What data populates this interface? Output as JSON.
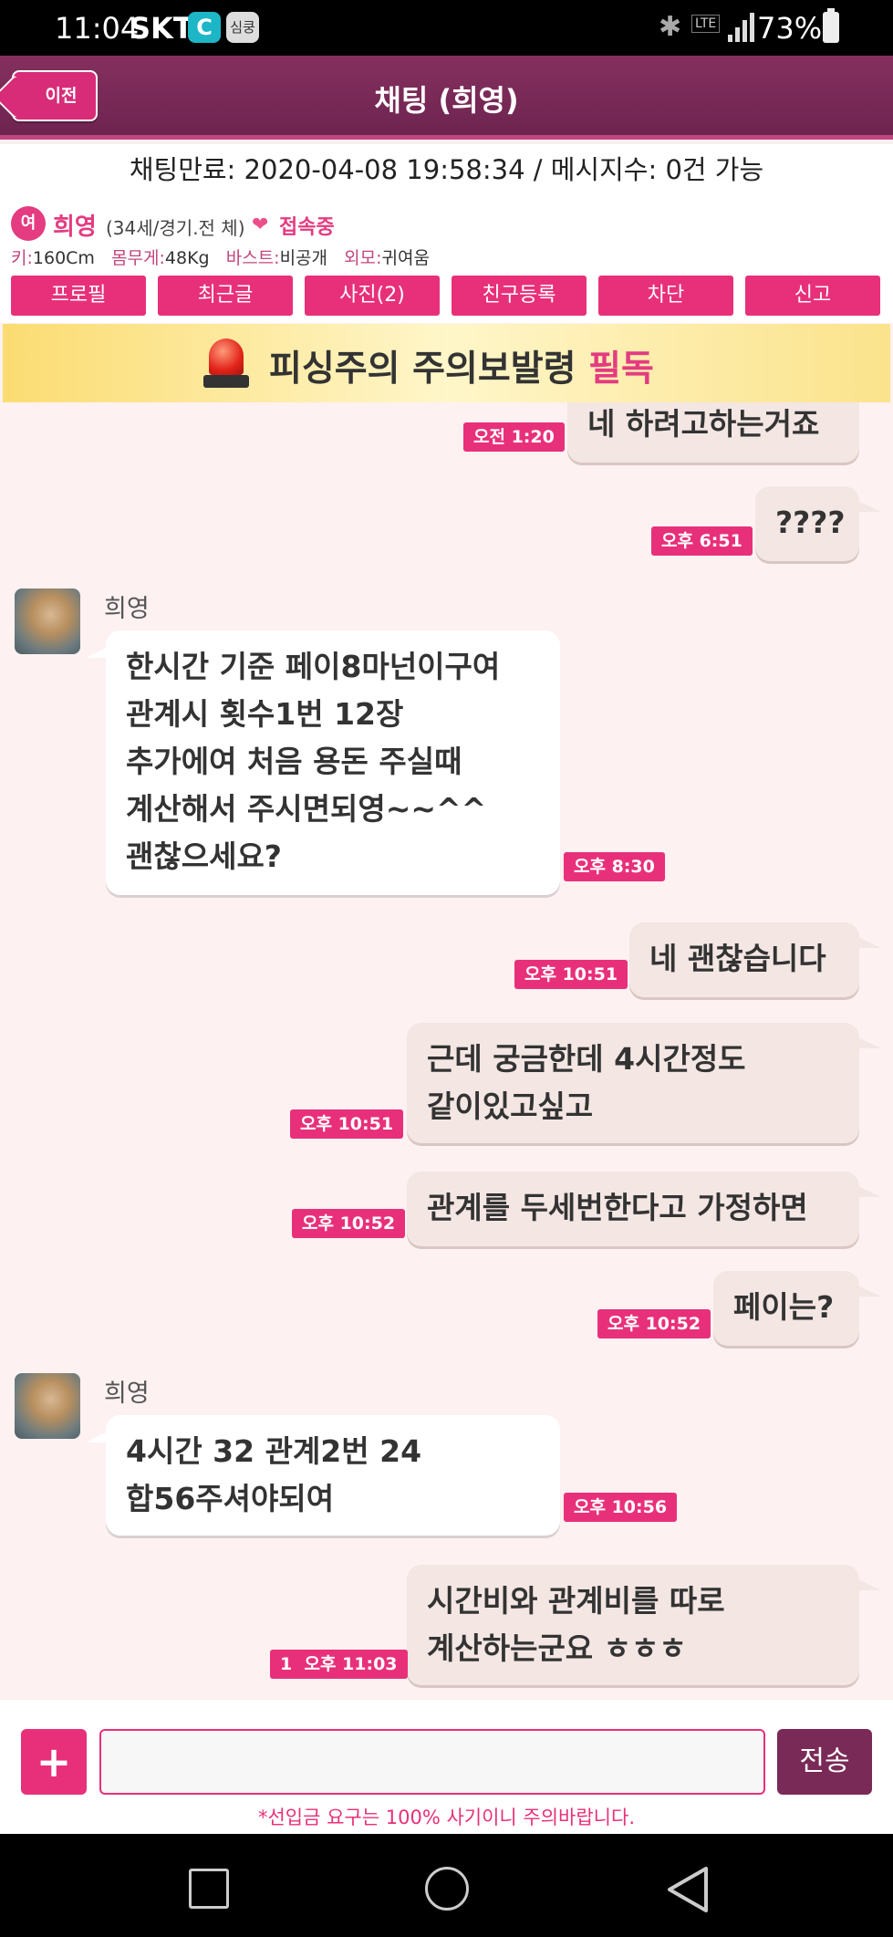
{
  "statusbar": {
    "time": "11:04",
    "carrier": "SKT",
    "app_c": "C",
    "app_s": "심쿵",
    "lte": "LTE",
    "battery": "73%"
  },
  "header": {
    "back_label": "이전",
    "title": "채팅 (희영)"
  },
  "info": {
    "line": "채팅만료: 2020-04-08 19:58:34 / 메시지수: 0건 가능"
  },
  "profile": {
    "gender": "여",
    "name": "희영",
    "details": "(34세/경기.전 체)",
    "status": "접속중",
    "height_label": "키:",
    "height": "160Cm",
    "weight_label": "몸무게:",
    "weight": "48Kg",
    "bust_label": "바스트:",
    "bust": "비공개",
    "look_label": "외모:",
    "look": "귀여움"
  },
  "tabs": [
    "프로필",
    "최근글",
    "사진(2)",
    "친구등록",
    "차단",
    "신고"
  ],
  "warning": {
    "text": "피싱주의 주의보발령 ",
    "highlight": "필독"
  },
  "messages": [
    {
      "type": "sent",
      "text": "네 하려고하는거죠",
      "time": "오전 1:20"
    },
    {
      "type": "sent",
      "text": "????",
      "time": "오후 6:51"
    },
    {
      "type": "recv",
      "sender": "희영",
      "lines": [
        "한시간 기준 페이8마넌이구여",
        "관계시 횟수1번 12장",
        "추가에여 처음 용돈 주실때",
        "계산해서 주시면되영~~^^",
        "괜찮으세요?"
      ],
      "time": "오후 8:30"
    },
    {
      "type": "sent",
      "text": "네 괜찮습니다",
      "time": "오후 10:51"
    },
    {
      "type": "sent",
      "lines": [
        "근데 궁금한데 4시간정도",
        "같이있고싶고"
      ],
      "time": "오후 10:51"
    },
    {
      "type": "sent",
      "text": "관계를 두세번한다고 가정하면",
      "time": "오후 10:52"
    },
    {
      "type": "sent",
      "text": "페이는?",
      "time": "오후 10:52"
    },
    {
      "type": "recv",
      "sender": "희영",
      "lines": [
        "4시간 32 관계2번 24",
        "합56주셔야되여"
      ],
      "time": "오후 10:56"
    },
    {
      "type": "sent",
      "lines": [
        "시간비와 관계비를 따로",
        "계산하는군요 ㅎㅎㅎ"
      ],
      "time": "오후 11:03",
      "unread": "1"
    }
  ],
  "input": {
    "plus": "+",
    "send": "전송",
    "placeholder": ""
  },
  "disclaimer": "*선입금 요구는 100% 사기이니 주의바랍니다."
}
